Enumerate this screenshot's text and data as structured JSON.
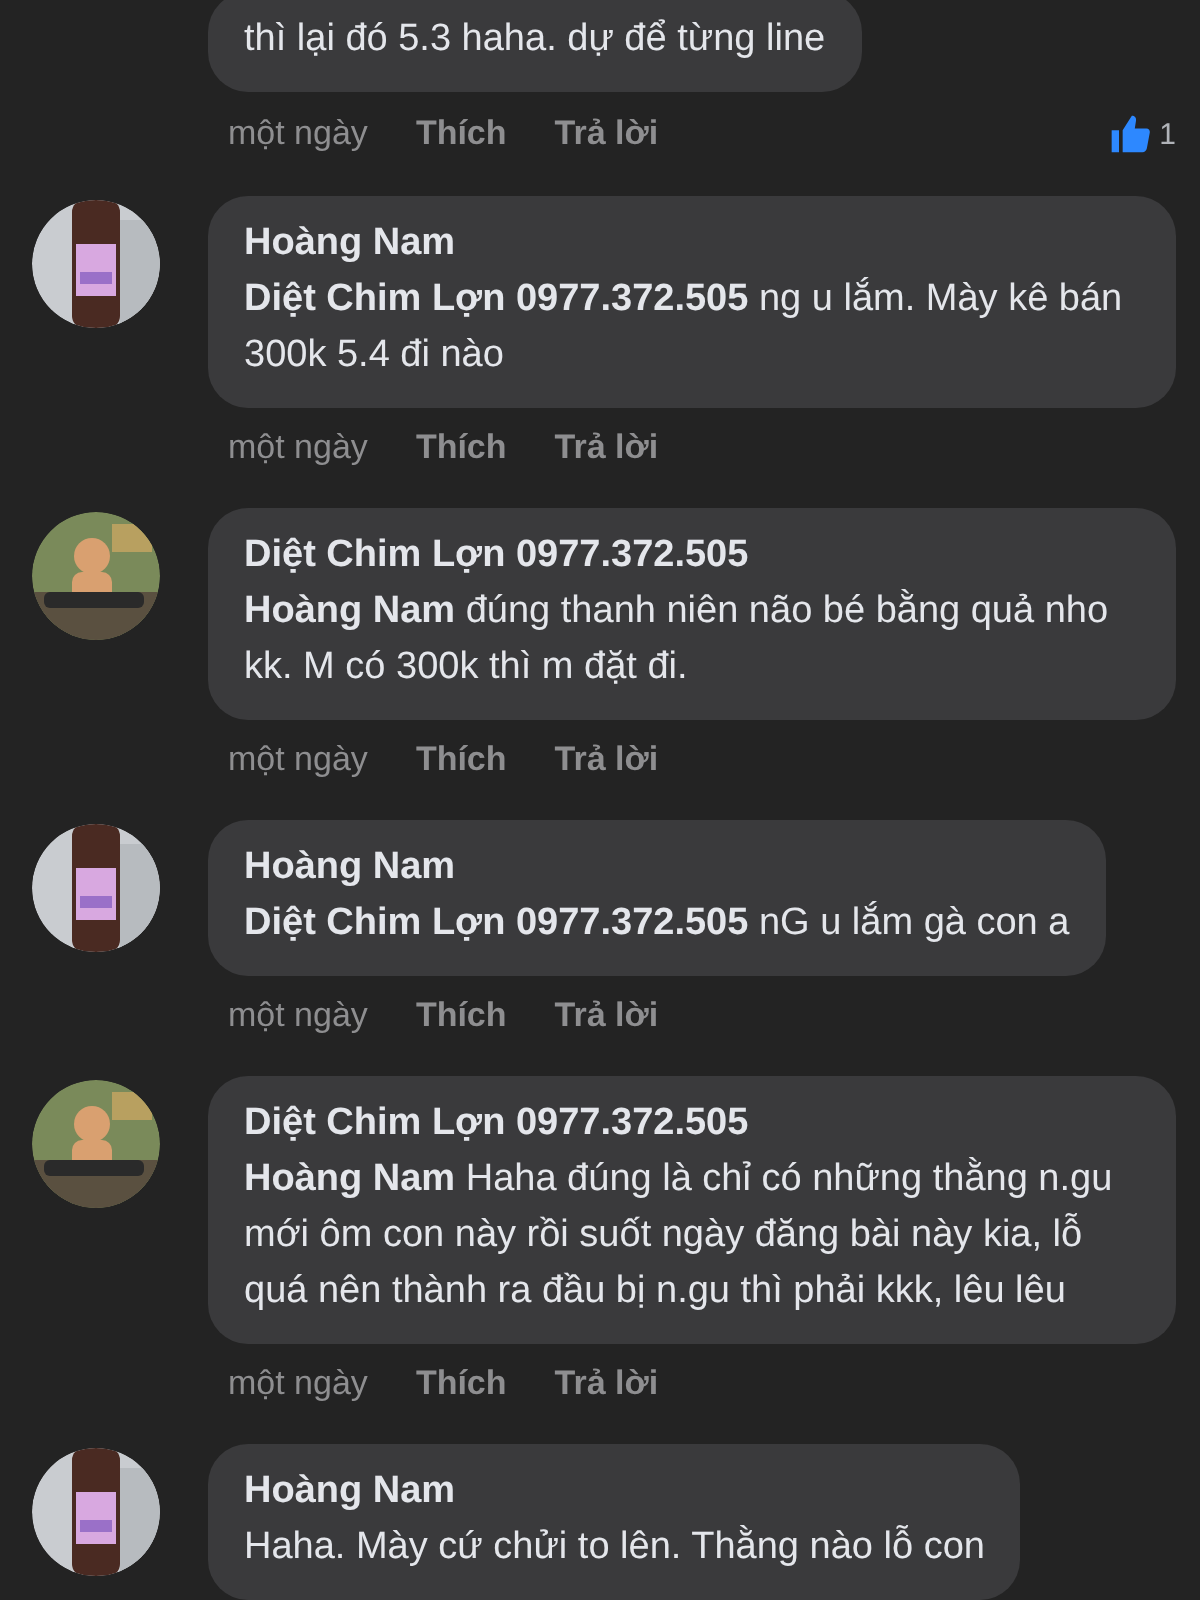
{
  "top_comment": {
    "text": "thì lại đó 5.3 haha. dự để từng line",
    "time": "một ngày",
    "like": "Thích",
    "reply": "Trả lời",
    "like_count": "1"
  },
  "comments": [
    {
      "author": "Hoàng Nam",
      "text": "**Diệt Chim Lợn 0977.372.505**   ng u lắm. Mày kê bán 300k 5.4 đi nào",
      "time": "một ngày",
      "like": "Thích",
      "reply": "Trả lời"
    },
    {
      "author": "Diệt Chim Lợn 0977.372.505",
      "text": "**Hoàng Nam**  đúng thanh niên não bé bằng quả nho kk. M có 300k thì m đặt đi.",
      "time": "một ngày",
      "like": "Thích",
      "reply": "Trả lời"
    },
    {
      "author": "Hoàng Nam",
      "text": "**Diệt Chim Lợn 0977.372.505**   nG u lắm gà con a",
      "time": "một ngày",
      "like": "Thích",
      "reply": "Trả lời"
    },
    {
      "author": "Diệt Chim Lợn 0977.372.505",
      "text": "**Hoàng Nam**  Haha đúng là chỉ có những thằng n.gu mới ôm con này rồi suốt ngày đăng bài này kia, lỗ quá nên thành ra đầu bị n.gu thì phải kkk, lêu lêu",
      "time": "một ngày",
      "like": "Thích",
      "reply": "Trả lời"
    },
    {
      "author": "Hoàng Nam",
      "text": "Haha. Mày cứ chửi to lên. Thằng nào lỗ con"
    }
  ]
}
